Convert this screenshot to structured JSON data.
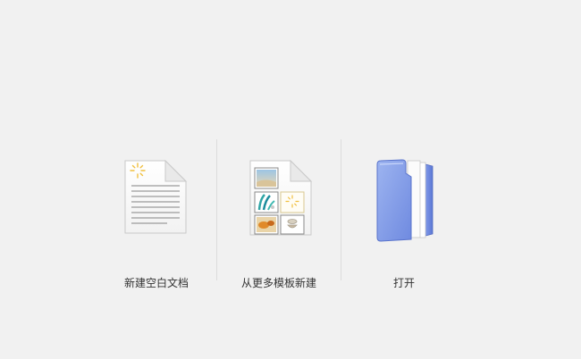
{
  "actions": {
    "new_blank_label": "新建空白文档",
    "new_from_template_label": "从更多模板新建",
    "open_label": "打开"
  },
  "icons": {
    "new_blank": "blank-document-icon",
    "new_from_template": "template-document-icon",
    "open": "folder-icon"
  },
  "colors": {
    "background": "#f1f1f1",
    "folder_blue": "#7b96e6",
    "sparkle": "#f0c040",
    "label": "#333333"
  }
}
